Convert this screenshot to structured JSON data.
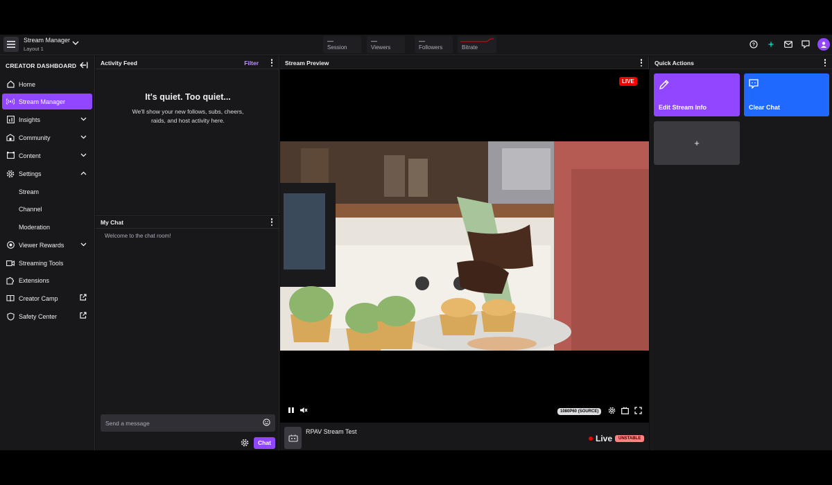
{
  "topbar": {
    "title": "Stream Manager",
    "subtitle": "Layout 1",
    "stats": [
      {
        "value": "—",
        "label": "Session"
      },
      {
        "value": "—",
        "label": "Viewers"
      },
      {
        "value": "—",
        "label": "Followers"
      },
      {
        "value": "",
        "label": "Bitrate"
      }
    ]
  },
  "sidebar": {
    "heading": "CREATOR DASHBOARD",
    "items": [
      {
        "label": "Home",
        "icon": "home-icon"
      },
      {
        "label": "Stream Manager",
        "icon": "broadcast-icon",
        "active": true
      },
      {
        "label": "Insights",
        "icon": "insights-icon",
        "expand": "down"
      },
      {
        "label": "Community",
        "icon": "community-icon",
        "expand": "down"
      },
      {
        "label": "Content",
        "icon": "content-icon",
        "expand": "down"
      },
      {
        "label": "Settings",
        "icon": "gear-icon",
        "expand": "up"
      },
      {
        "label": "Stream",
        "sub": true
      },
      {
        "label": "Channel",
        "sub": true
      },
      {
        "label": "Moderation",
        "sub": true
      },
      {
        "label": "Viewer Rewards",
        "icon": "rewards-icon",
        "expand": "down"
      },
      {
        "label": "Streaming Tools",
        "icon": "camera-icon"
      },
      {
        "label": "Extensions",
        "icon": "puzzle-icon"
      },
      {
        "label": "Creator Camp",
        "icon": "book-icon",
        "external": true
      },
      {
        "label": "Safety Center",
        "icon": "shield-icon",
        "external": true
      }
    ]
  },
  "activity": {
    "title": "Activity Feed",
    "filter": "Filter",
    "empty_title": "It's quiet. Too quiet...",
    "empty_body": "We'll show your new follows, subs, cheers, raids, and host activity here."
  },
  "chat": {
    "title": "My Chat",
    "welcome": "Welcome to the chat room!",
    "placeholder": "Send a message",
    "send_label": "Chat"
  },
  "preview": {
    "title": "Stream Preview",
    "live_badge": "LIVE",
    "quality": "1080P60 (SOURCE)",
    "stream_title": "RPAV Stream Test",
    "status": "Live",
    "health": "UNSTABLE"
  },
  "quick_actions": {
    "title": "Quick Actions",
    "items": [
      {
        "label": "Edit Stream Info",
        "color": "#9147ff",
        "icon": "pencil-icon"
      },
      {
        "label": "Clear Chat",
        "color": "#1f69ff",
        "icon": "chat-bubble-icon"
      },
      {
        "label": "+",
        "color": "#3a3a3f",
        "icon": "plus-icon"
      }
    ]
  },
  "colors": {
    "accent": "#9147ff",
    "blue": "#1f69ff",
    "live": "#eb0400"
  }
}
